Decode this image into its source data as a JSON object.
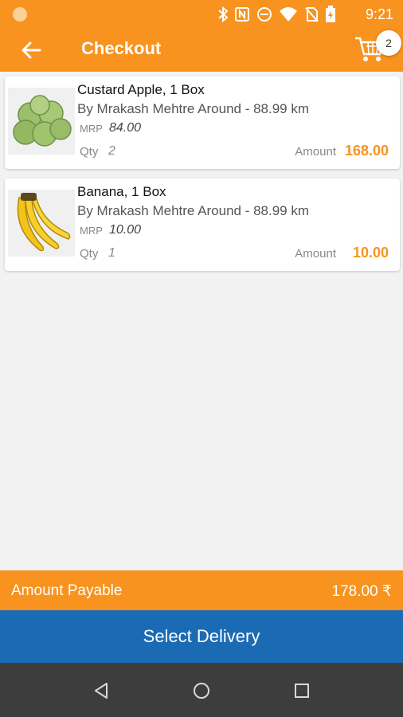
{
  "status_bar": {
    "time": "9:21",
    "icons": [
      "bluetooth-icon",
      "nfc-icon",
      "do-not-disturb-icon",
      "wifi-icon",
      "no-sim-icon",
      "battery-icon"
    ]
  },
  "app_bar": {
    "title": "Checkout",
    "cart_count": "2"
  },
  "items": [
    {
      "name": "Custard Apple, 1 Box",
      "seller": "By Mrakash Mehtre Around - 88.99 km",
      "mrp_label": "MRP",
      "mrp": "84.00",
      "qty_label": "Qty",
      "qty": "2",
      "amount_label": "Amount",
      "amount": "168.00"
    },
    {
      "name": "Banana, 1 Box",
      "seller": "By Mrakash Mehtre Around - 88.99 km",
      "mrp_label": "MRP",
      "mrp": "10.00",
      "qty_label": "Qty",
      "qty": "1",
      "amount_label": "Amount",
      "amount": "10.00"
    }
  ],
  "summary": {
    "label": "Amount Payable",
    "value": "178.00 ₹"
  },
  "action": {
    "label": "Select Delivery"
  },
  "colors": {
    "primary": "#f7931e",
    "action": "#1b6bb4",
    "navbar": "#3d3d3d"
  }
}
